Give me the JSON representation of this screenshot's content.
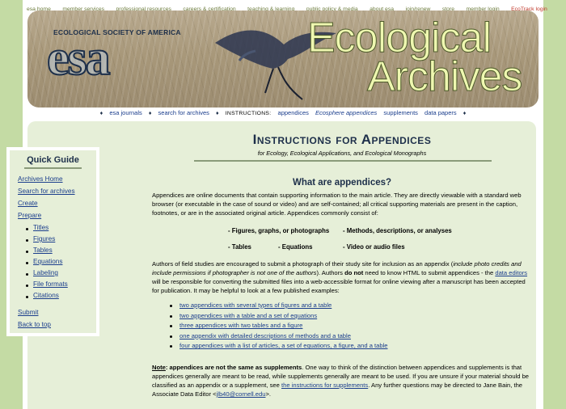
{
  "top_nav": [
    "esa home",
    "member services",
    "professional resources",
    "careers & certification",
    "teaching & learning",
    "public policy & media",
    "about esa",
    "join/renew",
    "store",
    "member login",
    "EcoTrack login"
  ],
  "banner": {
    "society": "ECOLOGICAL SOCIETY OF AMERICA",
    "logo": "esa",
    "title_line1": "Ecological",
    "title_line2": "Archives"
  },
  "sub_nav": {
    "links": [
      "esa journals",
      "search for archives"
    ],
    "instructions_label": "INSTRUCTIONS:",
    "instruction_links": [
      "appendices",
      "Ecosphere appendices",
      "supplements",
      "data papers"
    ]
  },
  "quick_guide": {
    "title": "Quick Guide",
    "top_links": [
      "Archives Home",
      "Search for archives",
      "Create",
      "Prepare"
    ],
    "prepare_items": [
      "Titles",
      "Figures",
      "Tables",
      "Equations",
      "Labeling",
      "File formats",
      "Citations"
    ],
    "bottom_links": [
      "Submit",
      "Back to top"
    ]
  },
  "main": {
    "title": "Instructions for Appendices",
    "subtitle": "for Ecology, Ecological Applications, and Ecological Monographs",
    "section_title": "What are appendices?",
    "intro": "Appendices are online documents that contain supporting information to the main article. They are directly viewable with a standard web browser (or executable in the case of sound or video) and are self-contained; all critical supporting materials are present in the caption, footnotes, or are in the associated original article. Appendices commonly consist of:",
    "consist_row1_left": "- Figures, graphs, or photographs",
    "consist_row1_right": "- Methods, descriptions, or analyses",
    "consist_row2_a": "- Tables",
    "consist_row2_b": "- Equations",
    "consist_row2_c": "- Video or audio files",
    "authors_p1": "Authors of field studies are encouraged to submit a photograph of their study site for inclusion as an appendix (",
    "authors_italic": "include photo credits and include permissions if photographer is not one of the authors",
    "authors_p2": "). Authors ",
    "authors_bold": "do not",
    "authors_p3": " need to know HTML to submit appendices - the ",
    "authors_link": "data editors",
    "authors_p4": " will be responsible for converting the submitted files into a web-accessible format for online viewing after a manuscript has been accepted for publication. It may be helpful to look at a few published examples:",
    "examples": [
      "two appendices with several types of figures and a table",
      "two appendices with a table and a set of equations",
      "three appendices with two tables and a figure",
      "one appendix with detailed descriptions of methods and a table",
      "four appendices with a list of articles, a set of equations, a figure, and a table"
    ],
    "note_label": "Note",
    "note_bold": ": appendices are not the same as supplements",
    "note_text1": ". One way to think of the distinction between appendices and supplements is that appendices generally are meant to be read, while supplements generally are meant to be used. If you are unsure if your material should be classified as an appendix or a supplement, see ",
    "note_link": "the instructions for supplements",
    "note_text2": ". Any further questions may be directed to Jane Bain, the Associate Data Editor <",
    "note_email": "jlb40@cornell.edu",
    "note_text3": ">."
  }
}
